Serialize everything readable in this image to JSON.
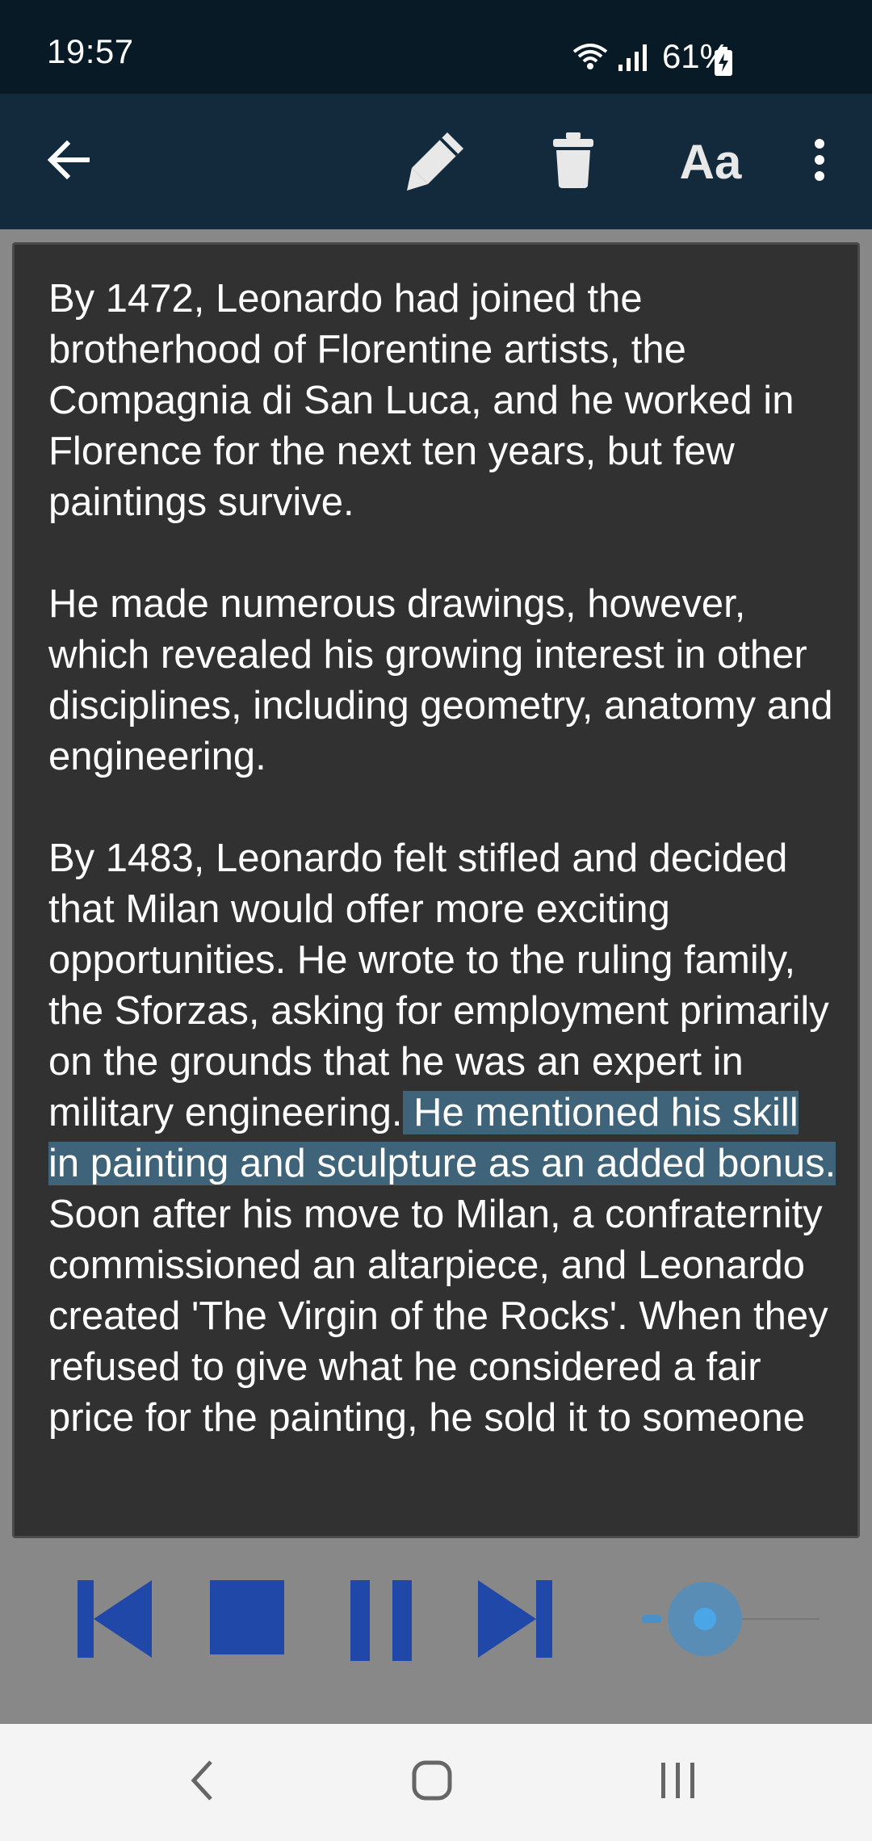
{
  "status_bar": {
    "time": "19:57",
    "battery": "61%"
  },
  "app_bar": {
    "back_icon": "arrow-left-icon",
    "edit_icon": "pencil-icon",
    "delete_icon": "trash-icon",
    "font_label": "Aa",
    "more_icon": "more-vertical-icon"
  },
  "content": {
    "paragraphs": [
      {
        "text": "By 1472, Leonardo had joined the brotherhood of Florentine artists, the Compagnia di San Luca, and he worked in Florence for the next ten years, but few paintings survive."
      },
      {
        "text": "He made numerous drawings, however, which revealed his growing interest in other disciplines, including geometry, anatomy and engineering."
      },
      {
        "before": "By 1483, Leonardo felt stifled and decided that Milan would offer more exciting opportunities. He wrote to the ruling family, the Sforzas, asking for employment primarily on the grounds that he was an expert in military engineering.",
        "highlighted": " He mentioned his skill in painting and sculpture as an added bonus.",
        "after": " Soon after his move to Milan, a confraternity commissioned an altarpiece, and Leonardo created 'The Virgin of the Rocks'. When they refused to give what he considered a fair price for the painting, he sold it to someone"
      }
    ]
  },
  "player": {
    "prev_icon": "skip-previous-icon",
    "stop_icon": "stop-icon",
    "pause_icon": "pause-icon",
    "next_icon": "skip-next-icon",
    "control_color": "#1f48a8",
    "speed_level": 0.1
  },
  "nav_bar": {
    "back_icon": "nav-back-icon",
    "home_icon": "nav-home-icon",
    "recent_icon": "nav-recent-apps-icon"
  },
  "colors": {
    "status_bar": "#081a26",
    "app_bar": "#122a3c",
    "content_bg": "#313131",
    "highlight": "#3f6479",
    "player_bg": "#888888"
  }
}
